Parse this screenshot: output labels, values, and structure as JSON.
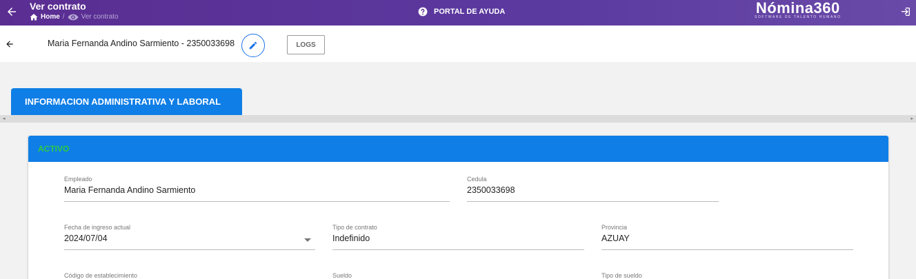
{
  "topbar": {
    "title": "Ver contrato",
    "breadcrumb": {
      "home": "Home",
      "separator": "/",
      "current": "Ver contrato"
    },
    "help_label": "PORTAL DE AYUDA",
    "logo_name": "Nómina360",
    "logo_sub": "SOFTWARE DE TALENTO HUMANO"
  },
  "header": {
    "employee_title": "Maria Fernanda Andino Sarmiento - 2350033698",
    "logs_label": "LOGS"
  },
  "tab": {
    "label": "INFORMACION ADMINISTRATIVA Y LABORAL"
  },
  "card": {
    "status": "ACTIVO",
    "fields": {
      "empleado": {
        "label": "Empleado",
        "value": "Maria Fernanda Andino Sarmiento"
      },
      "cedula": {
        "label": "Cedula",
        "value": "2350033698"
      },
      "fecha_ingreso": {
        "label": "Fecha de ingreso actual",
        "value": "2024/07/04"
      },
      "tipo_contrato": {
        "label": "Tipo de contrato",
        "value": "Indefinido"
      },
      "provincia": {
        "label": "Provincia",
        "value": "AZUAY"
      },
      "codigo_establecimiento": {
        "label": "Código de establecimiento",
        "value": ""
      },
      "sueldo": {
        "label": "Sueldo",
        "value": ""
      },
      "tipo_sueldo": {
        "label": "Tipo de sueldo",
        "value": ""
      }
    }
  },
  "colors": {
    "topbar": "#5a2d91",
    "primary": "#0f7ee6",
    "status_green": "#2ecc40"
  }
}
